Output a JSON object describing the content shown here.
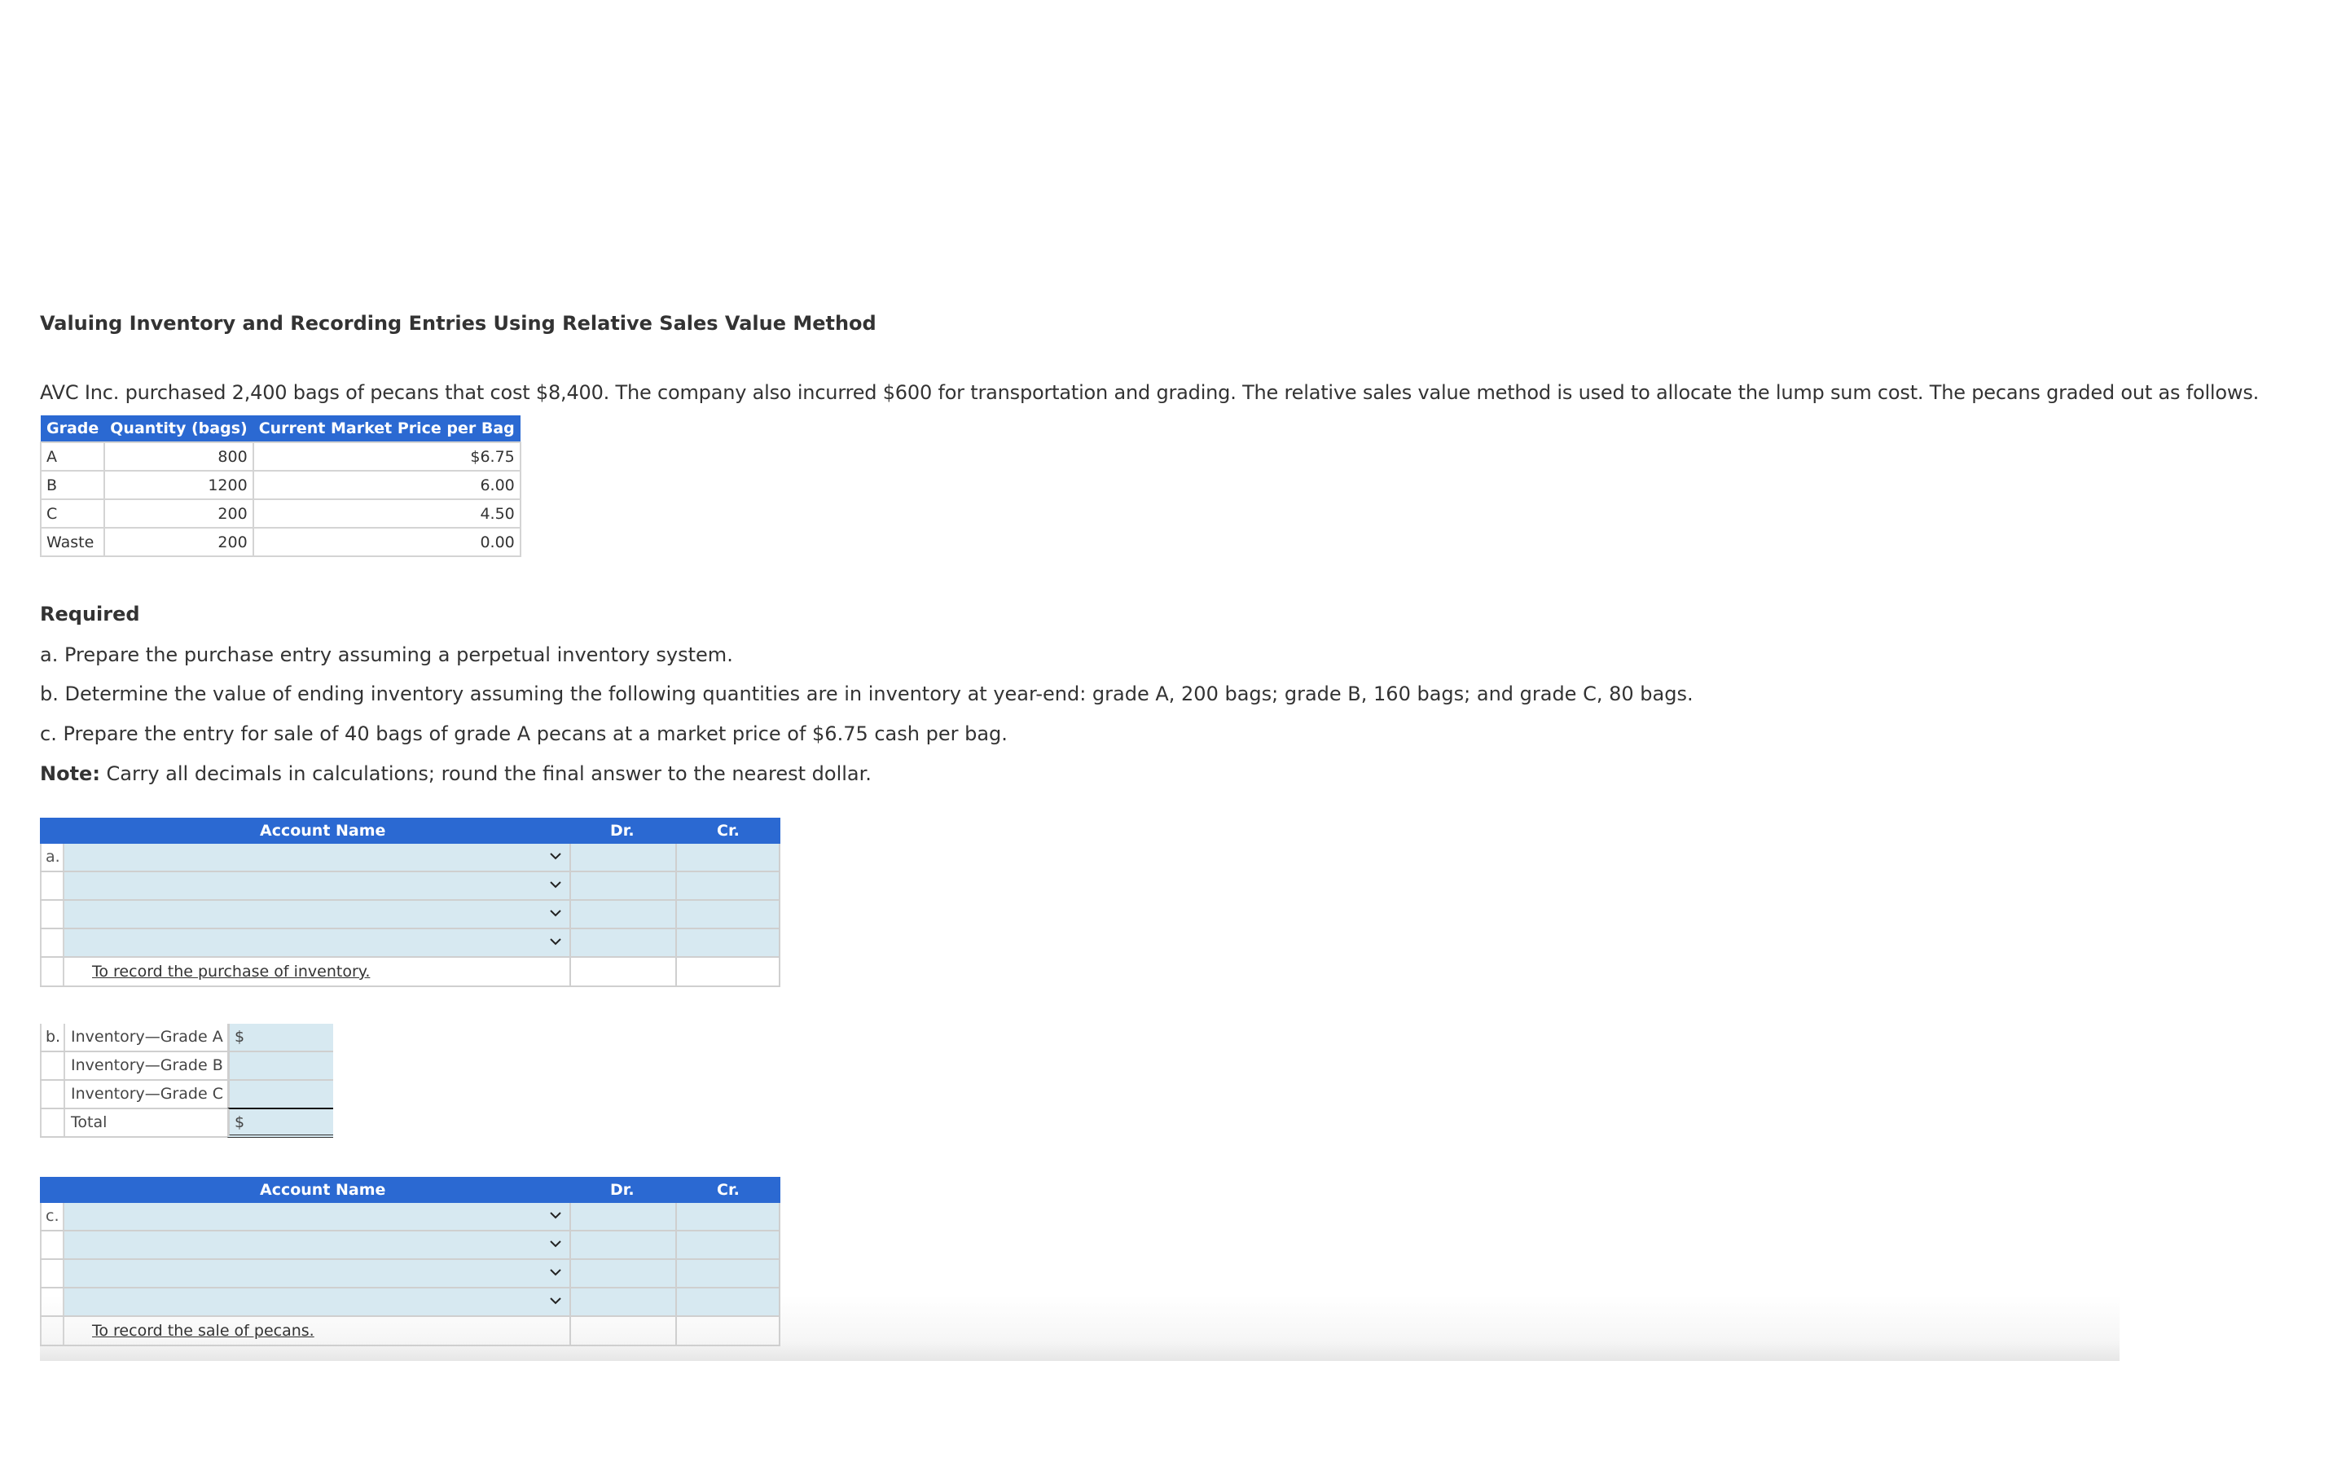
{
  "title": "Valuing Inventory and Recording Entries Using Relative Sales Value Method",
  "intro": "AVC Inc. purchased 2,400 bags of pecans that cost $8,400. The company also incurred $600 for transportation and grading. The relative sales value method is used to allocate the lump sum cost. The pecans graded out as follows.",
  "grade_table": {
    "headers": [
      "Grade",
      "Quantity (bags)",
      "Current Market Price per Bag"
    ],
    "rows": [
      {
        "grade": "A",
        "quantity": "800",
        "price": "$6.75"
      },
      {
        "grade": "B",
        "quantity": "1200",
        "price": "6.00"
      },
      {
        "grade": "C",
        "quantity": "200",
        "price": "4.50"
      },
      {
        "grade": "Waste",
        "quantity": "200",
        "price": "0.00"
      }
    ]
  },
  "required": {
    "heading": "Required",
    "a": "a. Prepare the purchase entry assuming a perpetual inventory system.",
    "b": "b. Determine the value of ending inventory assuming the following quantities are in inventory at year-end: grade A, 200 bags; grade B, 160 bags; and grade C, 80 bags.",
    "c": "c. Prepare the entry for sale of 40 bags of grade A pecans at a market price of $6.75 cash per bag.",
    "note_label": "Note:",
    "note_text": " Carry all decimals in calculations; round the final answer to the nearest dollar."
  },
  "journal_a": {
    "headers": {
      "account": "Account Name",
      "dr": "Dr.",
      "cr": "Cr."
    },
    "label": "a.",
    "rows": [
      {
        "account": "",
        "dr": "",
        "cr": ""
      },
      {
        "account": "",
        "dr": "",
        "cr": ""
      },
      {
        "account": "",
        "dr": "",
        "cr": ""
      },
      {
        "account": "",
        "dr": "",
        "cr": ""
      }
    ],
    "memo": "To record the purchase of inventory."
  },
  "part_b": {
    "label": "b.",
    "rows": [
      {
        "name": "Inventory—Grade A",
        "prefix": "$",
        "value": ""
      },
      {
        "name": "Inventory—Grade B",
        "prefix": "",
        "value": ""
      },
      {
        "name": "Inventory—Grade C",
        "prefix": "",
        "value": ""
      },
      {
        "name": "Total",
        "prefix": "$",
        "value": ""
      }
    ]
  },
  "journal_c": {
    "headers": {
      "account": "Account Name",
      "dr": "Dr.",
      "cr": "Cr."
    },
    "label": "c.",
    "rows": [
      {
        "account": "",
        "dr": "",
        "cr": ""
      },
      {
        "account": "",
        "dr": "",
        "cr": ""
      },
      {
        "account": "",
        "dr": "",
        "cr": ""
      },
      {
        "account": "",
        "dr": "",
        "cr": ""
      }
    ],
    "memo": "To record the sale of pecans."
  },
  "colors": {
    "header_blue": "#2b69d2",
    "input_blue": "#d7e9f1"
  }
}
